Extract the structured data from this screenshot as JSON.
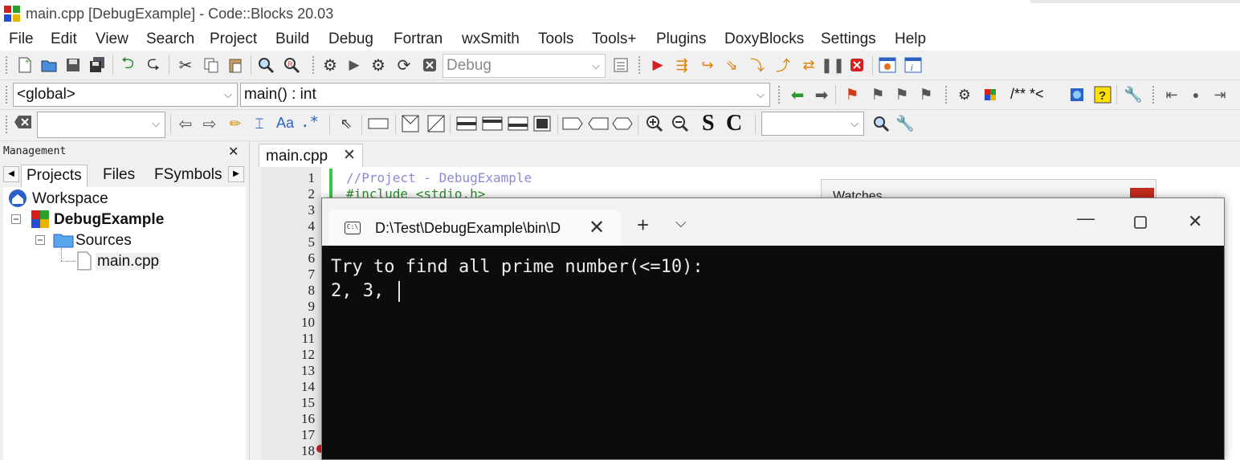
{
  "window": {
    "title": "main.cpp [DebugExample] - Code::Blocks 20.03"
  },
  "menu": [
    "File",
    "Edit",
    "View",
    "Search",
    "Project",
    "Build",
    "Debug",
    "Fortran",
    "wxSmith",
    "Tools",
    "Tools+",
    "Plugins",
    "DoxyBlocks",
    "Settings",
    "Help"
  ],
  "toolbar": {
    "build_target": "Debug",
    "scope": "<global>",
    "function": "main() : int",
    "doxy_comment": "/** *<",
    "regex_label": ".*",
    "bold_s": "S",
    "bold_c": "C",
    "search_value": "",
    "aa_label": "Aa"
  },
  "management": {
    "title": "Management",
    "tabs": [
      "Projects",
      "Files",
      "FSymbols"
    ],
    "tree": {
      "workspace": "Workspace",
      "project": "DebugExample",
      "folder": "Sources",
      "file": "main.cpp"
    }
  },
  "editor": {
    "tab": "main.cpp",
    "line_numbers": [
      "1",
      "2",
      "3",
      "4",
      "5",
      "6",
      "7",
      "8",
      "9",
      "10",
      "11",
      "12",
      "13",
      "14",
      "15",
      "16",
      "17",
      "18"
    ],
    "code": [
      "//Project - DebugExample",
      "#include <stdio.h>"
    ]
  },
  "watches": {
    "title": "Watches"
  },
  "console": {
    "tab_title": "D:\\Test\\DebugExample\\bin\\D",
    "icon_text": "C:\\",
    "lines": [
      "Try to find all prime number(<=10):",
      "2, 3, "
    ]
  },
  "colors": {
    "comment": "#8a8ad6",
    "preprocessor": "#2e8b2e",
    "console_bg": "#0c0c0c",
    "console_fg": "#ececec",
    "changebar": "#2ecc40"
  }
}
